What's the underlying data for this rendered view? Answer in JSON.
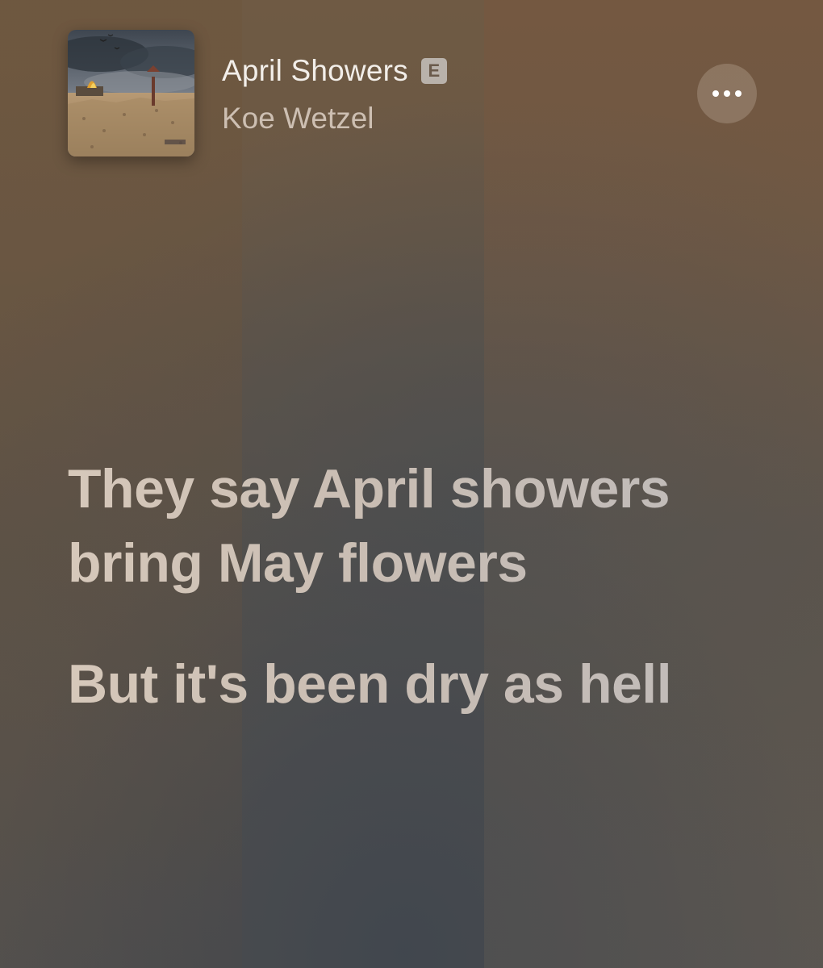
{
  "now_playing": {
    "title": "April Showers",
    "explicit_badge": "E",
    "artist": "Koe Wetzel",
    "artwork_icon": "album-artwork",
    "more_icon": "ellipsis-icon"
  },
  "lyrics": {
    "lines": [
      "They say April showers bring May flowers",
      "But it's been dry as hell"
    ]
  },
  "colors": {
    "title_text": "#f2eee9",
    "artist_text": "#cdbfb2",
    "lyric_text": "#d6c8ba",
    "badge_bg": "#b9b2ab",
    "background_top": "#6f5a44",
    "background_bottom": "#54524f"
  }
}
